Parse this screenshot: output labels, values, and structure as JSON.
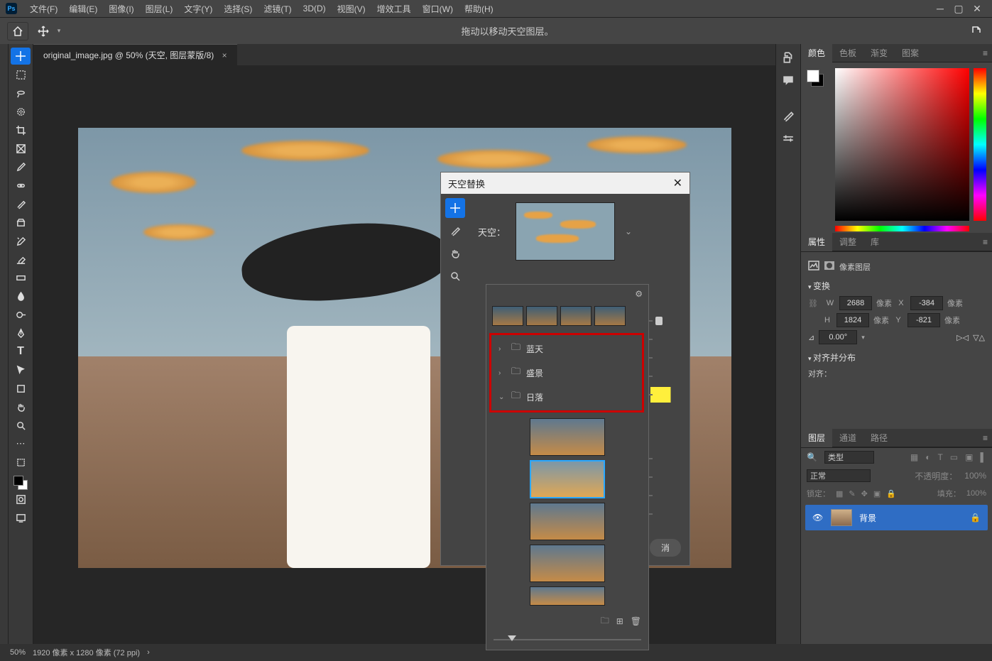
{
  "menubar": {
    "items": [
      "文件(F)",
      "编辑(E)",
      "图像(I)",
      "图层(L)",
      "文字(Y)",
      "选择(S)",
      "滤镜(T)",
      "3D(D)",
      "视图(V)",
      "增效工具",
      "窗口(W)",
      "帮助(H)"
    ]
  },
  "options": {
    "hint": "拖动以移动天空图层。"
  },
  "tab": {
    "title": "original_image.jpg @ 50% (天空, 图层蒙版/8)",
    "close": "×"
  },
  "panels": {
    "color_tabs": [
      "颜色",
      "色板",
      "渐变",
      "图案"
    ],
    "props_tabs": [
      "属性",
      "调整",
      "库"
    ],
    "layers_tabs": [
      "图层",
      "通道",
      "路径"
    ]
  },
  "properties": {
    "title": "像素图层",
    "section1": "变换",
    "W": "2688",
    "X": "-384",
    "H": "1824",
    "Y": "-821",
    "unit": "像素",
    "angle": "0.00°",
    "section2": "对齐并分布",
    "align_label": "对齐："
  },
  "layers": {
    "filter_placeholder": "类型",
    "blend_mode": "正常",
    "opacity_label": "不透明度：",
    "opacity_val": "100%",
    "lock_label": "锁定：",
    "fill_label": "填充：",
    "fill_val": "100%",
    "layer_name": "背景",
    "search_icon": "🔍"
  },
  "status": {
    "zoom": "50%",
    "info": "1920 像素 x 1280 像素 (72 ppi)",
    "arrow": "›"
  },
  "sky_dialog": {
    "title": "天空替换",
    "label": "天空：",
    "cancel": "消"
  },
  "sky_popover": {
    "folders": [
      {
        "chev": "›",
        "name": "蓝天"
      },
      {
        "chev": "›",
        "name": "盛景"
      },
      {
        "chev": "⌄",
        "name": "日落"
      }
    ]
  }
}
